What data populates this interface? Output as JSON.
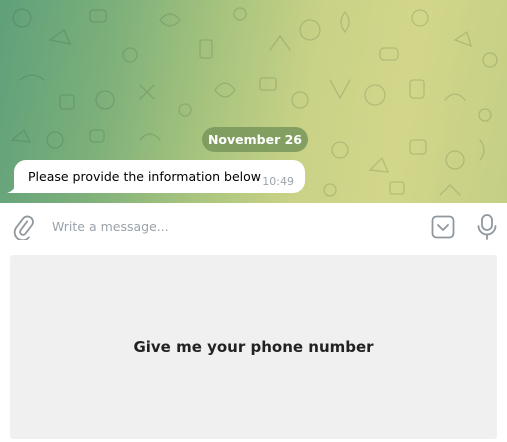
{
  "chat": {
    "date_label": "November 26",
    "messages": [
      {
        "text": "Please provide the information below",
        "time": "10:49"
      }
    ]
  },
  "composer": {
    "placeholder": "Write a message...",
    "attach_icon": "paperclip-icon",
    "keyboard_icon": "keyboard-toggle-icon",
    "mic_icon": "microphone-icon"
  },
  "reply_keyboard": {
    "buttons": [
      {
        "label": "Give me your phone number"
      }
    ]
  },
  "colors": {
    "bubble": "#ffffff",
    "date_pill": "#7d9a5c",
    "time": "#9aa3ab",
    "reply_button_bg": "#f0f0f0",
    "icon": "#8f989f"
  }
}
